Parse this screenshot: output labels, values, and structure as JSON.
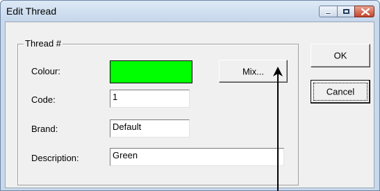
{
  "window": {
    "title": "Edit Thread"
  },
  "group": {
    "label": "Thread #"
  },
  "fields": {
    "colour": {
      "label": "Colour:",
      "color": "#00ff00"
    },
    "code": {
      "label": "Code:",
      "value": "1"
    },
    "brand": {
      "label": "Brand:",
      "value": "Default"
    },
    "description": {
      "label": "Description:",
      "value": "Green"
    }
  },
  "buttons": {
    "mix": "Mix...",
    "ok": "OK",
    "cancel": "Cancel"
  },
  "icons": {
    "minimize": "minimize-icon",
    "maximize": "maximize-icon",
    "close": "close-icon",
    "cursor": "arrow-cursor-icon"
  }
}
